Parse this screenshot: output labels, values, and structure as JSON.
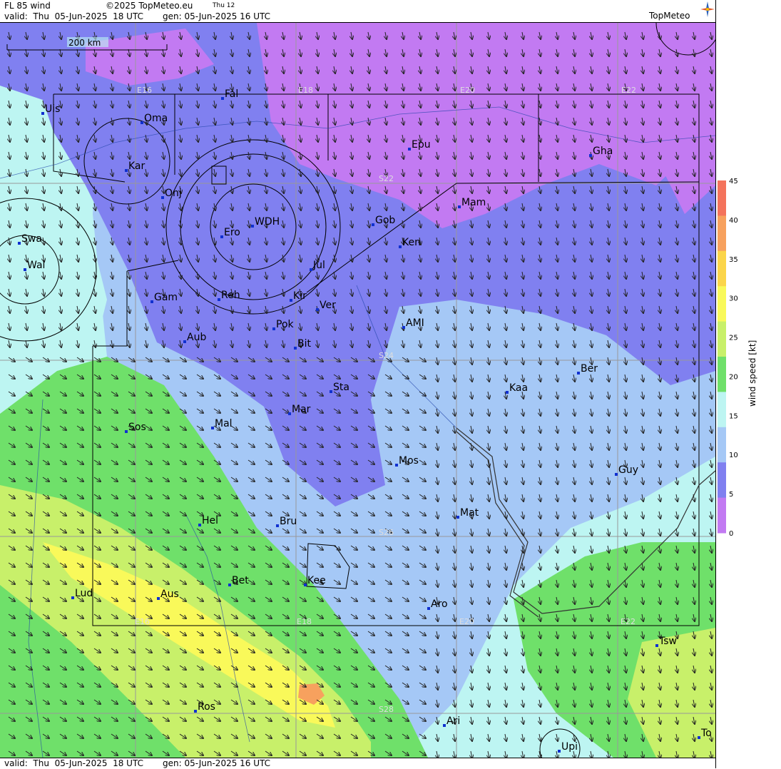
{
  "header": {
    "product": "FL 85 wind",
    "copyright": "©2025 TopMeteo.eu",
    "day": "Thu 12",
    "valid": "valid:  Thu  05-Jun-2025  18 UTC",
    "gen": "gen: 05-Jun-2025 16 UTC",
    "logo": "TopMeteo"
  },
  "footer": {
    "valid": "valid:  Thu  05-Jun-2025  18 UTC",
    "gen": "gen: 05-Jun-2025 16 UTC"
  },
  "scale_bar": "200 km",
  "grid_labels": {
    "lon_top": [
      "E16",
      "E18",
      "E20",
      "E22"
    ],
    "lon_bottom": [
      "E16",
      "E18",
      "E20",
      "E22"
    ],
    "lat": [
      "S22",
      "S24",
      "S26",
      "S28"
    ]
  },
  "places": [
    {
      "name": "Uis"
    },
    {
      "name": "Fal"
    },
    {
      "name": "Oma"
    },
    {
      "name": "Epu"
    },
    {
      "name": "Gha"
    },
    {
      "name": "Kar"
    },
    {
      "name": "Onj"
    },
    {
      "name": "Mam"
    },
    {
      "name": "Gob"
    },
    {
      "name": "WDH"
    },
    {
      "name": "Ero"
    },
    {
      "name": "Ken"
    },
    {
      "name": "Swa"
    },
    {
      "name": "Wal"
    },
    {
      "name": "Jul"
    },
    {
      "name": "Gam"
    },
    {
      "name": "Reh"
    },
    {
      "name": "Kir"
    },
    {
      "name": "Ver"
    },
    {
      "name": "AMI"
    },
    {
      "name": "Pok"
    },
    {
      "name": "Aub"
    },
    {
      "name": "Bit"
    },
    {
      "name": "Ber"
    },
    {
      "name": "Sta"
    },
    {
      "name": "Kaa"
    },
    {
      "name": "Mar"
    },
    {
      "name": "Sos"
    },
    {
      "name": "Mal"
    },
    {
      "name": "Mos"
    },
    {
      "name": "Guy"
    },
    {
      "name": "Mat"
    },
    {
      "name": "Hel"
    },
    {
      "name": "Bru"
    },
    {
      "name": "Bet"
    },
    {
      "name": "Kee"
    },
    {
      "name": "Lud"
    },
    {
      "name": "Aus"
    },
    {
      "name": "Aro"
    },
    {
      "name": "Tsw"
    },
    {
      "name": "Ros"
    },
    {
      "name": "Ari"
    },
    {
      "name": "To"
    },
    {
      "name": "Upi"
    }
  ],
  "colorbar": {
    "title": "wind  speed  [kt]",
    "ticks": [
      "45",
      "40",
      "35",
      "30",
      "25",
      "20",
      "15",
      "10",
      "5",
      "0"
    ],
    "colors": [
      "#f4735c",
      "#f7a15e",
      "#fbd54a",
      "#f9f95a",
      "#c8f06a",
      "#6fe06a",
      "#bdf5f2",
      "#a5c8f6",
      "#8080f0",
      "#c27af2"
    ]
  }
}
